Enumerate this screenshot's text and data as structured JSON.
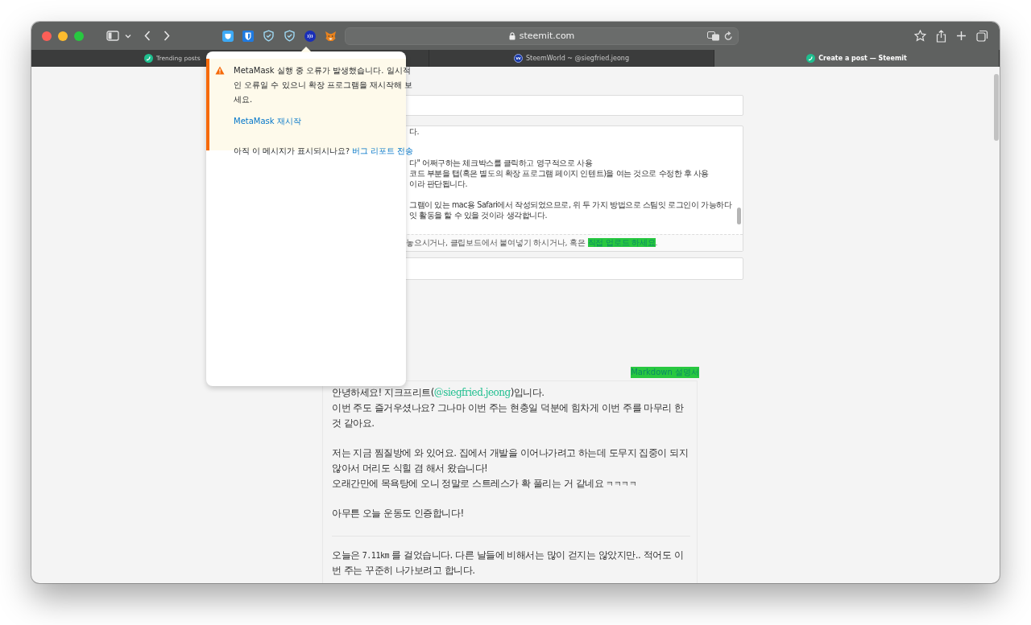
{
  "browser": {
    "address": "steemit.com",
    "tabs": [
      {
        "title": "Trending posts",
        "selected": false
      },
      {
        "title": "SteemWorld ~ @siegfried.jeong",
        "selected": false
      },
      {
        "title": "Create a post — Steemit",
        "selected": true
      }
    ]
  },
  "editor": {
    "body_paragraphs": [
      [
        "다."
      ],
      [
        "다\" 어쩌구하는 체크박스를 클릭하고 영구적으로 사용",
        "코드 부분을 탭(혹은 별도의 확장 프로그램 페이지 인텐트)을 여는 것으로 수정한 후 사용",
        "이라 판단됩니다."
      ],
      [
        "그램이 있는 mac용 Safari에서 작성되었으므로, 위 두 가지 방법으로 스팀잇 로그인이 가능하다",
        "잇 활동을 할 수 있을 것이라 생각합니다."
      ]
    ],
    "upload_hint": {
      "text": "놓으시거나, 클립보드에서 붙여넣기 하시거나, 혹은 ",
      "link": "직접 업로드 하세요",
      "end": "."
    }
  },
  "preview": {
    "help_link": "Markdown 설명서",
    "blocks": [
      {
        "kind": "paragraph",
        "lines": [
          [
            {
              "kind": "text",
              "text": "안녕하세요! 지크프리트("
            },
            {
              "kind": "link",
              "text": "@siegfried.jeong"
            },
            {
              "kind": "text",
              "text": ")입니다."
            }
          ],
          [
            {
              "kind": "text",
              "text": "이번 주도 즐거우셨나요? 그나마 이번 주는 현충일 덕분에 힘차게 이번 주를 마무리 한 것 같아요."
            }
          ]
        ]
      },
      {
        "kind": "paragraph",
        "lines": [
          [
            {
              "kind": "text",
              "text": "저는 지금 찜질방에 와 있어요. 집에서 개발을 이어나가려고 하는데 도무지 집중이 되지 않아서 머리도 식힐 겸 해서 왔습니다!"
            }
          ],
          [
            {
              "kind": "text",
              "text": "오래간만에 목욕탕에 오니 정말로 스트레스가 확 풀리는 거 같네요 "
            },
            {
              "kind": "code",
              "text": "ㅋㅋㅋㅋ"
            }
          ]
        ]
      },
      {
        "kind": "paragraph",
        "lines": [
          [
            {
              "kind": "text",
              "text": "아무튼 오늘 운동도 인증합니다!"
            }
          ]
        ]
      },
      {
        "kind": "rule"
      },
      {
        "kind": "paragraph",
        "lines": [
          [
            {
              "kind": "text",
              "text": "오늘은 "
            },
            {
              "kind": "code",
              "text": "7.11km"
            },
            {
              "kind": "text",
              "text": " 를 걸었습니다. 다른 날들에 비해서는 많이 걷지는 않았지만.. 적어도 이번 주는 꾸준히 나가보려고 합니다."
            }
          ]
        ]
      }
    ]
  },
  "popup": {
    "message": "MetaMask 실행 중 오류가 발생했습니다. 일시적인 오류일 수 있으니 확장 프로그램을 재시작해 보세요.",
    "restart_link": "MetaMask 재시작",
    "question": "아직 이 메시지가 표시되시나요? ",
    "report_link": "버그 리포트 전송"
  }
}
